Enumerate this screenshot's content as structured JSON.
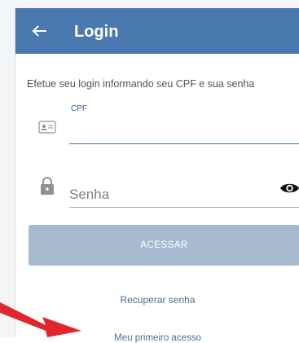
{
  "app_bar": {
    "back_icon": "arrow-left-icon",
    "title": "Login"
  },
  "form": {
    "subtitle": "Efetue seu login informando seu CPF e sua senha",
    "cpf": {
      "label": "CPF",
      "value": "",
      "icon": "id-card-icon"
    },
    "password": {
      "placeholder": "Senha",
      "icon": "lock-icon",
      "toggle_icon": "eye-icon"
    },
    "submit_label": "ACESSAR"
  },
  "links": {
    "recover_password": "Recuperar senha",
    "first_access": "Meu primeiro acesso"
  },
  "colors": {
    "primary": "#4a79b0",
    "button_disabled": "#a8bad0",
    "link": "#466d9c",
    "annotation_arrow": "#e3262d"
  }
}
